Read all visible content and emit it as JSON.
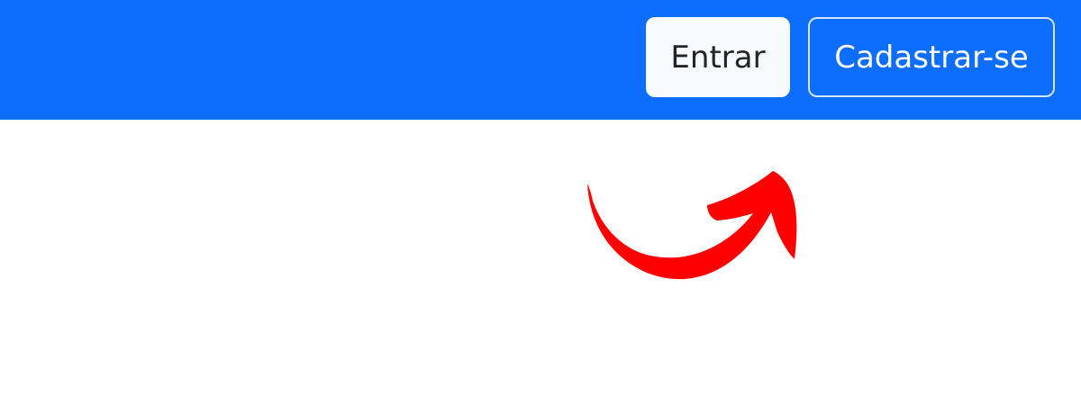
{
  "navbar": {
    "background_color": "#0d6efd",
    "buttons": {
      "login_label": "Entrar",
      "signup_label": "Cadastrar-se"
    }
  },
  "annotation": {
    "arrow_color": "#ff0000",
    "arrow_icon": "curved-arrow-icon"
  }
}
